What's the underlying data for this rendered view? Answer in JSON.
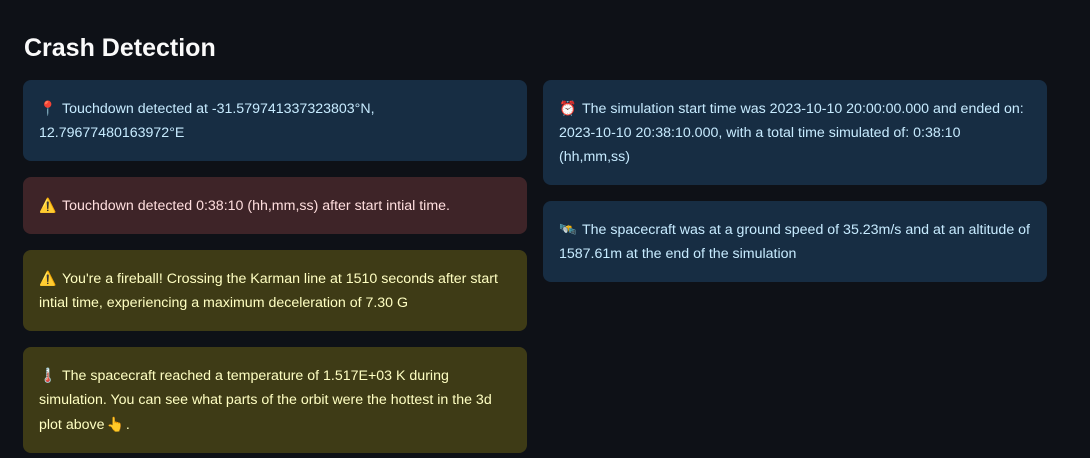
{
  "header": {
    "title": "Crash Detection"
  },
  "left": [
    {
      "kind": "info",
      "icon": "📍",
      "icon_name": "pin-icon",
      "text": "Touchdown detected at -31.579741337323803°N, 12.79677480163972°E"
    },
    {
      "kind": "error",
      "icon": "⚠️",
      "icon_name": "warning-icon",
      "text": "Touchdown detected 0:38:10 (hh,mm,ss) after start intial time."
    },
    {
      "kind": "warning",
      "icon": "⚠️",
      "icon_name": "warning-icon",
      "text": "You're a fireball! Crossing the Karman line at 1510 seconds after start intial time, experiencing a maximum deceleration of 7.30 G"
    },
    {
      "kind": "warning",
      "icon": "🌡️",
      "icon_name": "thermometer-icon",
      "text": "The spacecraft reached a temperature of 1.517E+03 K during simulation. You can see what parts of the orbit were the hottest in the 3d plot above",
      "trailing_icon": "👆",
      "trailing_icon_name": "pointing-up-icon",
      "trailing_text": "."
    }
  ],
  "right": [
    {
      "kind": "info",
      "icon": "⏰",
      "icon_name": "alarm-clock-icon",
      "text": "The simulation start time was 2023-10-10 20:00:00.000 and ended on: 2023-10-10 20:38:10.000, with a total time simulated of: 0:38:10 (hh,mm,ss)"
    },
    {
      "kind": "info",
      "icon": "🛰️",
      "icon_name": "satellite-icon",
      "text": "The spacecraft was at a ground speed of 35.23m/s and at an altitude of 1587.61m at the end of the simulation"
    }
  ],
  "colors": {
    "background": "#0e1117",
    "info_bg": "#172d43",
    "error_bg": "#3e2428",
    "warning_bg": "#3e3b16"
  }
}
